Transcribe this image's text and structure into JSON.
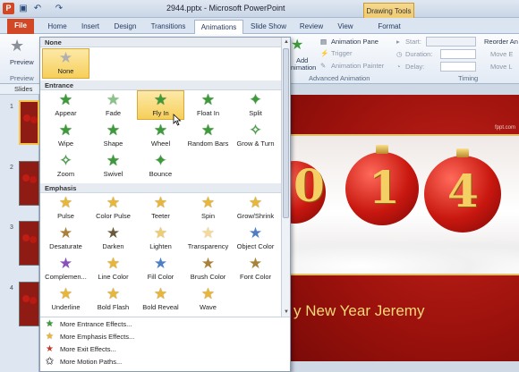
{
  "window": {
    "title": "2944.pptx - Microsoft PowerPoint",
    "context_tab_group": "Drawing Tools",
    "app_icon": "P"
  },
  "tabs": [
    {
      "label": "File"
    },
    {
      "label": "Home"
    },
    {
      "label": "Insert"
    },
    {
      "label": "Design"
    },
    {
      "label": "Transitions"
    },
    {
      "label": "Animations"
    },
    {
      "label": "Slide Show"
    },
    {
      "label": "Review"
    },
    {
      "label": "View"
    },
    {
      "label": "Format"
    }
  ],
  "ribbon": {
    "preview_label": "Preview",
    "preview_group": "Preview",
    "add_animation_line1": "Add",
    "add_animation_line2": "nimation",
    "animation_pane": "Animation Pane",
    "trigger": "Trigger",
    "animation_painter": "Animation Painter",
    "advanced_group": "Advanced Animation",
    "start_label": "Start:",
    "duration_label": "Duration:",
    "delay_label": "Delay:",
    "timing_group": "Timing",
    "reorder_label": "Reorder An",
    "move_earlier": "Move E",
    "move_later": "Move L"
  },
  "slides_pane": {
    "tab_label": "Slides",
    "numbers": [
      "1",
      "2",
      "3",
      "4"
    ]
  },
  "gallery": {
    "none_section": "None",
    "none_item": "None",
    "entrance_section": "Entrance",
    "entrance_items": [
      "Appear",
      "Fade",
      "Fly In",
      "Float In",
      "Split",
      "Wipe",
      "Shape",
      "Wheel",
      "Random Bars",
      "Grow & Turn",
      "Zoom",
      "Swivel",
      "Bounce"
    ],
    "emphasis_section": "Emphasis",
    "emphasis_items": [
      "Pulse",
      "Color Pulse",
      "Teeter",
      "Spin",
      "Grow/Shrink",
      "Desaturate",
      "Darken",
      "Lighten",
      "Transparency",
      "Object Color",
      "Complemen...",
      "Line Color",
      "Fill Color",
      "Brush Color",
      "Font Color",
      "Underline",
      "Bold Flash",
      "Bold Reveal",
      "Wave"
    ],
    "selected": "Fly In",
    "more": [
      "More Entrance Effects...",
      "More Emphasis Effects...",
      "More Exit Effects...",
      "More Motion Paths..."
    ]
  },
  "slide": {
    "text": "y New Year Jeremy",
    "credit": "fppt.com",
    "digits": [
      "0",
      "1",
      "4"
    ]
  },
  "colors": {
    "file_tab": "#d24726",
    "entrance_star": "#3d9a3b",
    "emphasis_star": "#e8b73a",
    "slide_red": "#9b110c"
  }
}
